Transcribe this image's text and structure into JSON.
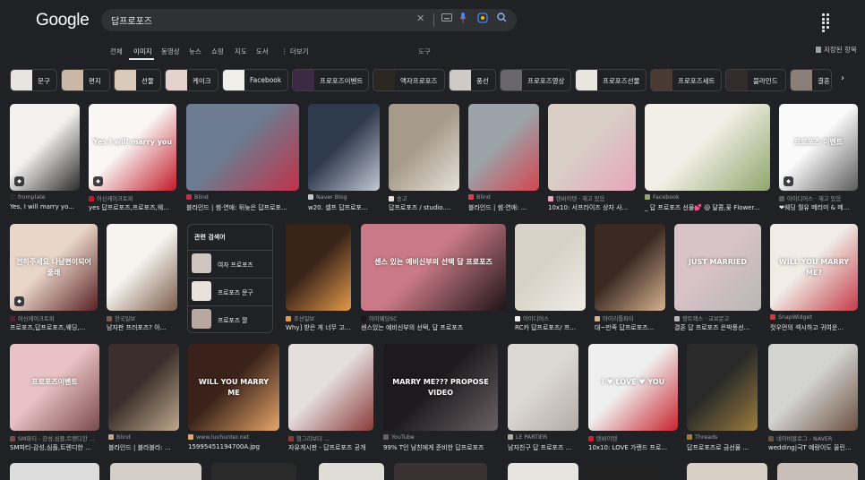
{
  "header": {
    "logo": "Google",
    "search_value": "답프로포즈",
    "icons": [
      "clear-icon",
      "keyboard-icon",
      "mic-icon",
      "lens-icon",
      "search-icon",
      "apps-icon"
    ]
  },
  "tabs": [
    {
      "label": "전체"
    },
    {
      "label": "이미지",
      "active": true
    },
    {
      "label": "동영상"
    },
    {
      "label": "뉴스"
    },
    {
      "label": "쇼핑"
    },
    {
      "label": "지도"
    },
    {
      "label": "도서"
    },
    {
      "label": "⋮ 더보기"
    }
  ],
  "tools_label": "도구",
  "saved_label": "저장된 항목",
  "chips": [
    "문구",
    "편지",
    "선물",
    "케이크",
    "Facebook",
    "프로포즈이벤트",
    "액자프로포즈",
    "풍선",
    "프로포즈영상",
    "프로포즈선물",
    "프로포즈세트",
    "블라인드",
    "결혼"
  ],
  "related": {
    "title": "관련 검색어",
    "items": [
      "여자 프로포즈",
      "프로포즈 문구",
      "프로포즈 짤"
    ]
  },
  "results": [
    {
      "source": "fromplate",
      "title": "Yes, I will marry yo...",
      "colors": [
        "#f4f2ef",
        "#2b2b2b"
      ],
      "badge": true
    },
    {
      "source": "어신케이크토퍼",
      "title": "yes 답프로포즈,프로포즈,웨...",
      "colors": [
        "#faf6f4",
        "#c21a2a"
      ],
      "badge": true,
      "text": "Yes I will marry you"
    },
    {
      "source": "Blind",
      "title": "블라인드 | 썸·연애: 뒤늦은 답프로포...",
      "colors": [
        "#6d7c90",
        "#c2314a"
      ]
    },
    {
      "source": "Naver Blog",
      "title": "w20. 셀프 답프로포...",
      "colors": [
        "#2e3a4d",
        "#c3c9d4"
      ]
    },
    {
      "source": "송고",
      "title": "답프로포즈 / studio....",
      "colors": [
        "#a69b8a",
        "#e6e2d8"
      ]
    },
    {
      "source": "Blind",
      "title": "블라인드 | 썸·연애: ...",
      "colors": [
        "#9ca2a9",
        "#d4454f"
      ]
    },
    {
      "source": "텐바이텐 · 재고 있음",
      "title": "10x10: 서프라이즈 상자 사...",
      "colors": [
        "#d9cfc6",
        "#e6a5b8"
      ]
    },
    {
      "source": "Facebook",
      "title": "_ 답 프로포즈 선물💕 @ 달콤,꽃 Flower...",
      "colors": [
        "#f2efe6",
        "#8fa66c"
      ]
    },
    {
      "source": "아이디어스 · 재고 있음",
      "title": "❤웨딩 월유 메리미 & 메...",
      "colors": [
        "#fafafa",
        "#5a5a5a"
      ],
      "badge": true,
      "text": "프로포즈 이벤트"
    },
    {
      "source": "어신케이크토퍼",
      "title": "프로포즈,답프로포즈,웨딩,...",
      "colors": [
        "#e9d6c9",
        "#5a1f24"
      ],
      "badge": true,
      "text": "전하주세요 나남편이되어줄래"
    },
    {
      "source": "한국일보",
      "title": "남자판 프러포즈? 아...",
      "colors": [
        "#f7f4ef",
        "#7a5c4a"
      ]
    },
    {
      "source": "조선일보",
      "title": "Why] 받은 게 너무 고...",
      "colors": [
        "#3a2418",
        "#e39a4a"
      ]
    },
    {
      "source": "아이웨딩SC",
      "title": "센스있는 예비신부의 선택, 답 프로포즈",
      "colors": [
        "#c97a86",
        "#1e1416"
      ],
      "text": "센스 있는 예비신부의 선택 답 프로포즈"
    },
    {
      "source": "아이디어스",
      "title": "RC카 답프로포즈/ 프...",
      "colors": [
        "#d8d3c8",
        "#f0ede6"
      ]
    },
    {
      "source": "마이리틀파티",
      "title": "대~만족 답프로포즈...",
      "colors": [
        "#3b2a22",
        "#d6b290"
      ]
    },
    {
      "source": "핫트랙스 · 교보문고",
      "title": "결혼 답 프로포즈 은박풍선...",
      "colors": [
        "#d8c3c8",
        "#b9b6b4"
      ],
      "text": "JUST MARRIED"
    },
    {
      "source": "SnapWidget",
      "title": "컷우먼의 섹시하고 귀여운...",
      "colors": [
        "#f1ece6",
        "#c43b48"
      ],
      "text": "WILL YOU MARRY ME?"
    },
    {
      "source": "SM파티 - 강성,심플,트렌디한 ...",
      "title": "SM파티-감성,심플,트렌디한 ...",
      "colors": [
        "#e8c2c5",
        "#7a4a4a"
      ],
      "text": "프로포즈이벤트"
    },
    {
      "source": "Blind",
      "title": "블라인드 | 블라블라: ...",
      "colors": [
        "#3a2f2a",
        "#bfa98c"
      ]
    },
    {
      "source": "www.luvhunter.net",
      "title": "15995451194700A.jpg",
      "colors": [
        "#3a221a",
        "#e6a66a"
      ],
      "text": "WILL YOU MARRY ME"
    },
    {
      "source": "헝그리보더 ...",
      "title": "자유게시판 - 답프로포즈 공개",
      "colors": [
        "#e5dede",
        "#8a3a3a"
      ]
    },
    {
      "source": "YouTube",
      "title": "99% T인 남친에게 준비한 답프로포즈",
      "colors": [
        "#1c1a1c",
        "#6a6064"
      ],
      "text": "MARRY ME??? PROPOSE VIDEO"
    },
    {
      "source": "LE PARTIER",
      "title": "남자친구 답 프로포즈 ...",
      "colors": [
        "#dcd8d3",
        "#b3aca5"
      ]
    },
    {
      "source": "텐바이텐",
      "title": "10x10: LOVE 가랜드 프로...",
      "colors": [
        "#efefef",
        "#c8232e"
      ],
      "text": "I ♥ LOVE ♥ YOU"
    },
    {
      "source": "Threads",
      "title": "답프로포즈로 금선물 ...",
      "colors": [
        "#2a2a2a",
        "#9c7c3c"
      ]
    },
    {
      "source": "네이버블로그 - NAVER",
      "title": "wedding|극T 예랑이도 울린...",
      "colors": [
        "#d4d4d2",
        "#6a5040"
      ]
    }
  ]
}
